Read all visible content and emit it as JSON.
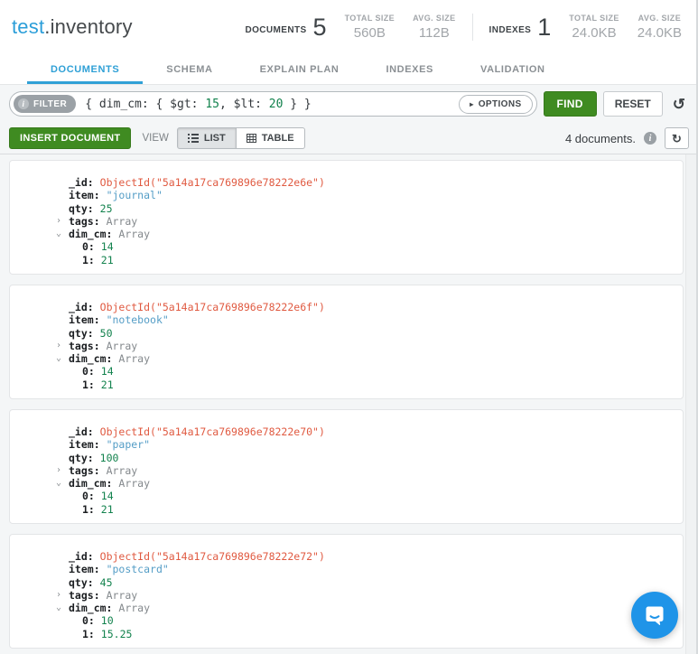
{
  "header": {
    "namespace_db": "test",
    "namespace_rest": ".inventory",
    "stats": {
      "documents_label": "DOCUMENTS",
      "documents_count": "5",
      "documents_total_size_label": "TOTAL SIZE",
      "documents_total_size": "560B",
      "documents_avg_size_label": "AVG. SIZE",
      "documents_avg_size": "112B",
      "indexes_label": "INDEXES",
      "indexes_count": "1",
      "indexes_total_size_label": "TOTAL SIZE",
      "indexes_total_size": "24.0KB",
      "indexes_avg_size_label": "AVG. SIZE",
      "indexes_avg_size": "24.0KB"
    }
  },
  "tabs": [
    {
      "label": "DOCUMENTS",
      "active": true
    },
    {
      "label": "SCHEMA",
      "active": false
    },
    {
      "label": "EXPLAIN PLAN",
      "active": false
    },
    {
      "label": "INDEXES",
      "active": false
    },
    {
      "label": "VALIDATION",
      "active": false
    }
  ],
  "query_bar": {
    "filter_label": "FILTER",
    "filter_parts": {
      "pre": "{ dim_cm: { $gt: ",
      "gt_value": "15",
      "mid": ", $lt: ",
      "lt_value": "20",
      "post": " } }"
    },
    "options_label": "OPTIONS",
    "find_label": "FIND",
    "reset_label": "RESET"
  },
  "toolbar": {
    "insert_label": "INSERT DOCUMENT",
    "view_label": "VIEW",
    "list_label": "LIST",
    "table_label": "TABLE",
    "count_text": "4 documents."
  },
  "field_keys": {
    "id": "_id:",
    "item": "item:",
    "qty": "qty:",
    "tags": "tags:",
    "dim": "dim_cm:",
    "i0": "0:",
    "i1": "1:"
  },
  "array_label": "Array",
  "documents": [
    {
      "id_value": "ObjectId(\"5a14a17ca769896e78222e6e\")",
      "item_value": "\"journal\"",
      "qty_value": "25",
      "dim0": "14",
      "dim1": "21"
    },
    {
      "id_value": "ObjectId(\"5a14a17ca769896e78222e6f\")",
      "item_value": "\"notebook\"",
      "qty_value": "50",
      "dim0": "14",
      "dim1": "21"
    },
    {
      "id_value": "ObjectId(\"5a14a17ca769896e78222e70\")",
      "item_value": "\"paper\"",
      "qty_value": "100",
      "dim0": "14",
      "dim1": "21"
    },
    {
      "id_value": "ObjectId(\"5a14a17ca769896e78222e72\")",
      "item_value": "\"postcard\"",
      "qty_value": "45",
      "dim0": "10",
      "dim1": "15.25"
    }
  ],
  "icons": {
    "filter_info": "i",
    "options_caret": "▸",
    "history": "↺",
    "doc_info": "i",
    "refresh": "↻",
    "chevron_right": "›",
    "chevron_down": "⌄"
  },
  "colors": {
    "accent_blue": "#2b9ed9",
    "tab_active_blue": "#2fa0d6",
    "button_green": "#3f8b21",
    "objectid_color": "#e05a41",
    "string_color": "#549dc6",
    "number_color": "#12824d",
    "intercom_blue": "#1f94e8"
  }
}
